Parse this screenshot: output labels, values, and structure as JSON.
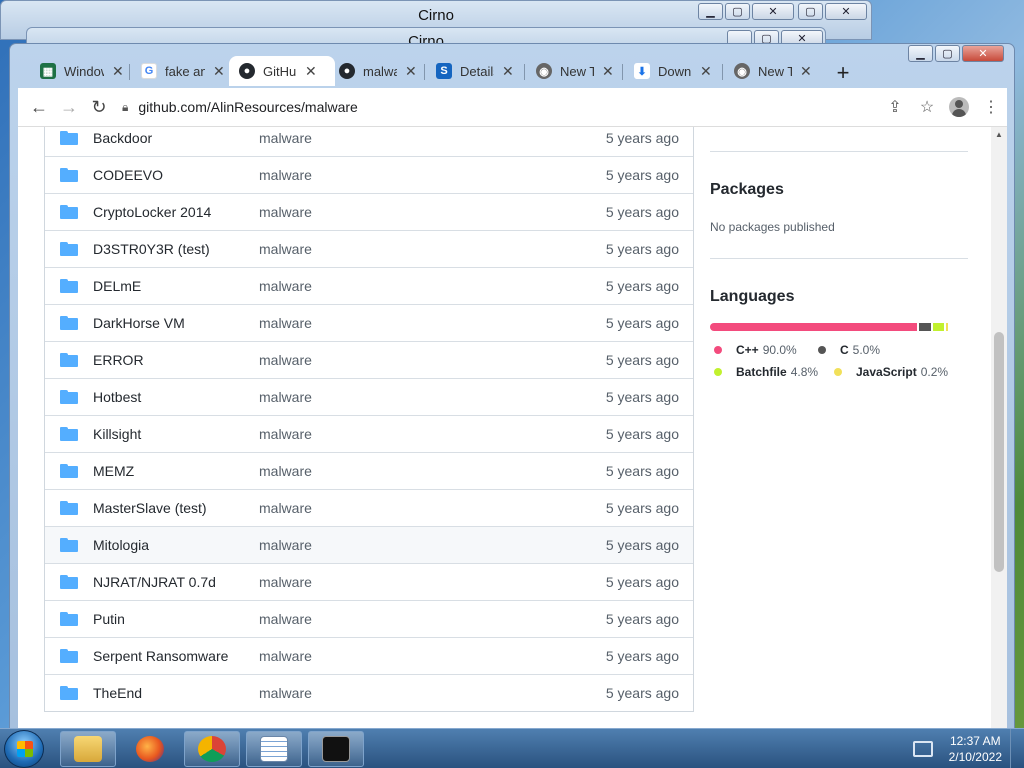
{
  "background_windows": [
    {
      "title": "Cirno"
    },
    {
      "title": "Cirno"
    }
  ],
  "browser": {
    "tabs": [
      {
        "label": "Windows Defender",
        "icon": "spreadsheet-icon",
        "color": "#1e7145"
      },
      {
        "label": "fake antivirus",
        "icon": "google-icon",
        "color": "#4285f4"
      },
      {
        "label": "GitHub",
        "icon": "github-icon",
        "color": "#24292f",
        "active": true
      },
      {
        "label": "malware",
        "icon": "github-icon",
        "color": "#24292f"
      },
      {
        "label": "Details",
        "icon": "s-icon",
        "color": "#1565c0"
      },
      {
        "label": "New Tab",
        "icon": "chrome-icon",
        "color": "#555"
      },
      {
        "label": "Downloads",
        "icon": "download-icon",
        "color": "#1a73e8"
      },
      {
        "label": "New Tab",
        "icon": "chrome-icon",
        "color": "#555"
      }
    ],
    "address": "github.com/AlinResources/malware"
  },
  "files": [
    {
      "name": "Backdoor",
      "commit": "malware",
      "age": "5 years ago"
    },
    {
      "name": "CODEEVO",
      "commit": "malware",
      "age": "5 years ago"
    },
    {
      "name": "CryptoLocker 2014",
      "commit": "malware",
      "age": "5 years ago"
    },
    {
      "name": "D3STR0Y3R (test)",
      "commit": "malware",
      "age": "5 years ago"
    },
    {
      "name": "DELmE",
      "commit": "malware",
      "age": "5 years ago"
    },
    {
      "name": "DarkHorse VM",
      "commit": "malware",
      "age": "5 years ago"
    },
    {
      "name": "ERROR",
      "commit": "malware",
      "age": "5 years ago"
    },
    {
      "name": "Hotbest",
      "commit": "malware",
      "age": "5 years ago"
    },
    {
      "name": "Killsight",
      "commit": "malware",
      "age": "5 years ago"
    },
    {
      "name": "MEMZ",
      "commit": "malware",
      "age": "5 years ago"
    },
    {
      "name": "MasterSlave (test)",
      "commit": "malware",
      "age": "5 years ago"
    },
    {
      "name": "Mitologia",
      "commit": "malware",
      "age": "5 years ago"
    },
    {
      "name": "NJRAT/NJRAT 0.7d",
      "commit": "malware",
      "age": "5 years ago"
    },
    {
      "name": "Putin",
      "commit": "malware",
      "age": "5 years ago"
    },
    {
      "name": "Serpent Ransomware",
      "commit": "malware",
      "age": "5 years ago"
    },
    {
      "name": "TheEnd",
      "commit": "malware",
      "age": "5 years ago"
    }
  ],
  "hovered_row": 11,
  "sidebar": {
    "packages_title": "Packages",
    "packages_text": "No packages published",
    "languages_title": "Languages",
    "languages": [
      {
        "name": "C++",
        "percent": "90.0%",
        "value": 90.0,
        "color": "#f34b7d"
      },
      {
        "name": "C",
        "percent": "5.0%",
        "value": 5.0,
        "color": "#555555"
      },
      {
        "name": "Batchfile",
        "percent": "4.8%",
        "value": 4.8,
        "color": "#c1f12e"
      },
      {
        "name": "JavaScript",
        "percent": "0.2%",
        "value": 0.2,
        "color": "#f1e05a"
      }
    ]
  },
  "taskbar": {
    "time": "12:37 AM",
    "date": "2/10/2022",
    "apps": [
      "file-explorer-icon",
      "firefox-icon",
      "chrome-icon",
      "notepad-icon",
      "cmd-icon"
    ]
  }
}
